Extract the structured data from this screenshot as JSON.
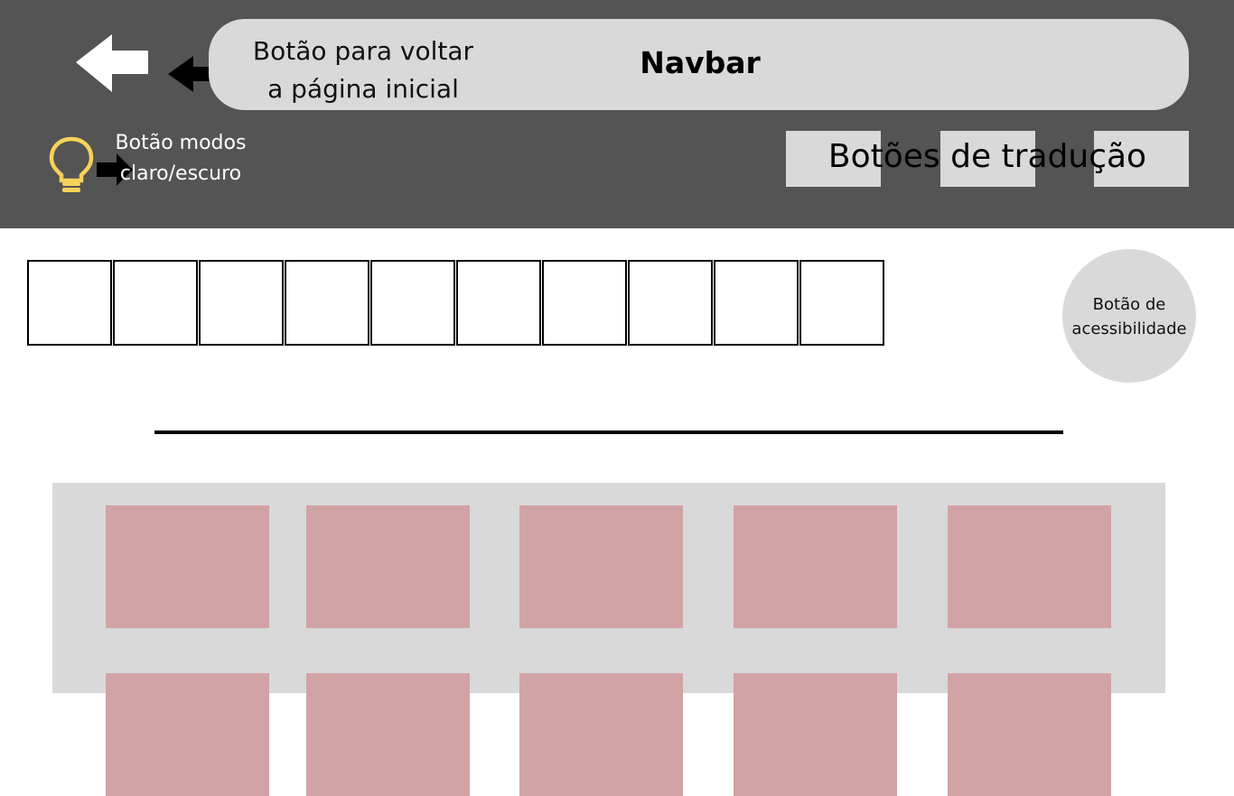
{
  "header": {
    "back_note": "Botão para voltar a página inicial",
    "navbar_title": "Navbar",
    "theme_note": "Botão modos claro/escuro",
    "translation_label": "Botões de tradução",
    "icons": {
      "back": "arrow-left-icon",
      "pointer": "arrow-right-icon",
      "theme": "lightbulb-icon"
    }
  },
  "accessibility": {
    "label": "Botão de acessibilidade"
  },
  "colors": {
    "header_bg": "#545454",
    "navbar_bg": "#d9d9d9",
    "card": "#d1a3a4",
    "bulb": "#f5d25a"
  }
}
